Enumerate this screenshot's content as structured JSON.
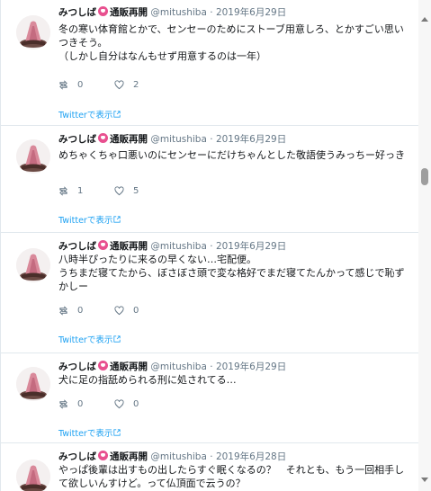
{
  "tweets": [
    {
      "name": "みつしば",
      "badge": "通販再開",
      "handle": "@mitushiba",
      "sep": "·",
      "date": "2019年6月29日",
      "text": "冬の寒い体育館とかで、センセーのためにストーブ用意しろ、とかすごい思いつきそう。\n（しかし自分はなんもせず用意するのは一年）",
      "retweets": "0",
      "likes": "2",
      "view_label": "Twitterで表示"
    },
    {
      "name": "みつしば",
      "badge": "通販再開",
      "handle": "@mitushiba",
      "sep": "·",
      "date": "2019年6月29日",
      "text": "めちゃくちゃ口悪いのにセンセーにだけちゃんとした敬語使うみっちー好っき",
      "retweets": "1",
      "likes": "5",
      "view_label": "Twitterで表示"
    },
    {
      "name": "みつしば",
      "badge": "通販再開",
      "handle": "@mitushiba",
      "sep": "·",
      "date": "2019年6月29日",
      "text": "八時半ぴったりに来るの早くない…宅配便。\nうちまだ寝てたから、ぼさぼさ頭で変な格好でまだ寝てたんかって感じで恥ずかしー",
      "retweets": "0",
      "likes": "0",
      "view_label": "Twitterで表示"
    },
    {
      "name": "みつしば",
      "badge": "通販再開",
      "handle": "@mitushiba",
      "sep": "·",
      "date": "2019年6月29日",
      "text": "犬に足の指舐められる刑に処されてる…",
      "retweets": "0",
      "likes": "0",
      "view_label": "Twitterで表示"
    },
    {
      "name": "みつしば",
      "badge": "通販再開",
      "handle": "@mitushiba",
      "sep": "·",
      "date": "2019年6月28日",
      "text": "やっぱ後輩は出すもの出したらすぐ眠くなるの？　それとも、もう一回相手して欲しいんすけど。って仏頂面で云うの？",
      "retweets": "",
      "likes": "",
      "view_label": ""
    }
  ],
  "icons": {
    "retweet": "retweet-icon",
    "like": "heart-icon",
    "external": "external-link-icon",
    "avatar": "avatar-image"
  },
  "colors": {
    "link": "#1da1f2",
    "meta": "#657786",
    "border": "#e1e8ed",
    "emoji": "#e8508f"
  }
}
